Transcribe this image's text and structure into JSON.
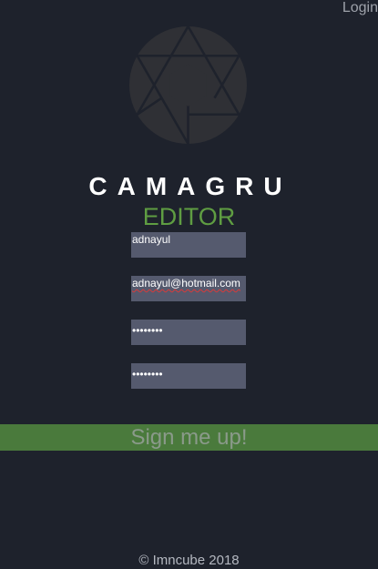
{
  "header": {
    "login_label": "Login"
  },
  "brand": {
    "logo_icon": "camera-aperture-icon",
    "title": "CAMAGRU",
    "subtitle": "EDITOR",
    "title_color": "#ffffff",
    "subtitle_color": "#5f9d42"
  },
  "form": {
    "username_value": "adnayul",
    "email_value": "adnayul@hotmail.com",
    "password_masked": "••••••••",
    "confirm_password_masked": "••••••••",
    "submit_label": "Sign me up!",
    "field_color": "#555a6e",
    "submit_color": "#4a7a3c"
  },
  "footer": {
    "copyright": "© Imncube 2018"
  },
  "theme": {
    "background": "#1e222c"
  }
}
